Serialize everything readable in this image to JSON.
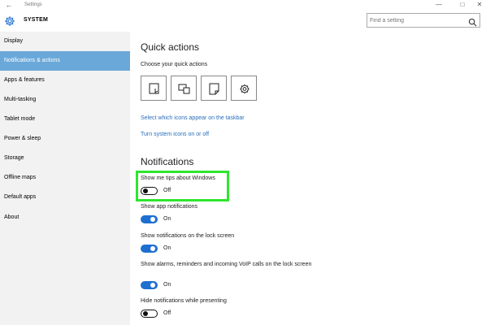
{
  "window": {
    "title": "Settings"
  },
  "header": {
    "title": "SYSTEM"
  },
  "search": {
    "placeholder": "Find a setting"
  },
  "sidebar": {
    "items": [
      {
        "label": "Display"
      },
      {
        "label": "Notifications & actions",
        "active": true
      },
      {
        "label": "Apps & features"
      },
      {
        "label": "Multi-tasking"
      },
      {
        "label": "Tablet mode"
      },
      {
        "label": "Power & sleep"
      },
      {
        "label": "Storage"
      },
      {
        "label": "Offline maps"
      },
      {
        "label": "Default apps"
      },
      {
        "label": "About"
      }
    ]
  },
  "quick_actions": {
    "title": "Quick actions",
    "subtitle": "Choose your quick actions",
    "tiles": [
      {
        "icon": "tablet-mode-icon"
      },
      {
        "icon": "connect-icon"
      },
      {
        "icon": "note-icon"
      },
      {
        "icon": "settings-icon"
      }
    ],
    "links": [
      {
        "label": "Select which icons appear on the taskbar"
      },
      {
        "label": "Turn system icons on or off"
      }
    ]
  },
  "notifications": {
    "title": "Notifications",
    "settings": [
      {
        "label": "Show me tips about Windows",
        "state": "Off",
        "on": false
      },
      {
        "label": "Show app notifications",
        "state": "On",
        "on": true
      },
      {
        "label": "Show notifications on the lock screen",
        "state": "On",
        "on": true
      },
      {
        "label": "Show alarms, reminders and incoming VoIP calls on the lock screen",
        "state": "On",
        "on": true
      },
      {
        "label": "Hide notifications while presenting",
        "state": "Off",
        "on": false
      }
    ]
  },
  "colors": {
    "accent": "#1e6fd0",
    "sidebar_active": "#6aa8d9",
    "highlight": "#2ee62e",
    "link": "#2a6ebb"
  }
}
